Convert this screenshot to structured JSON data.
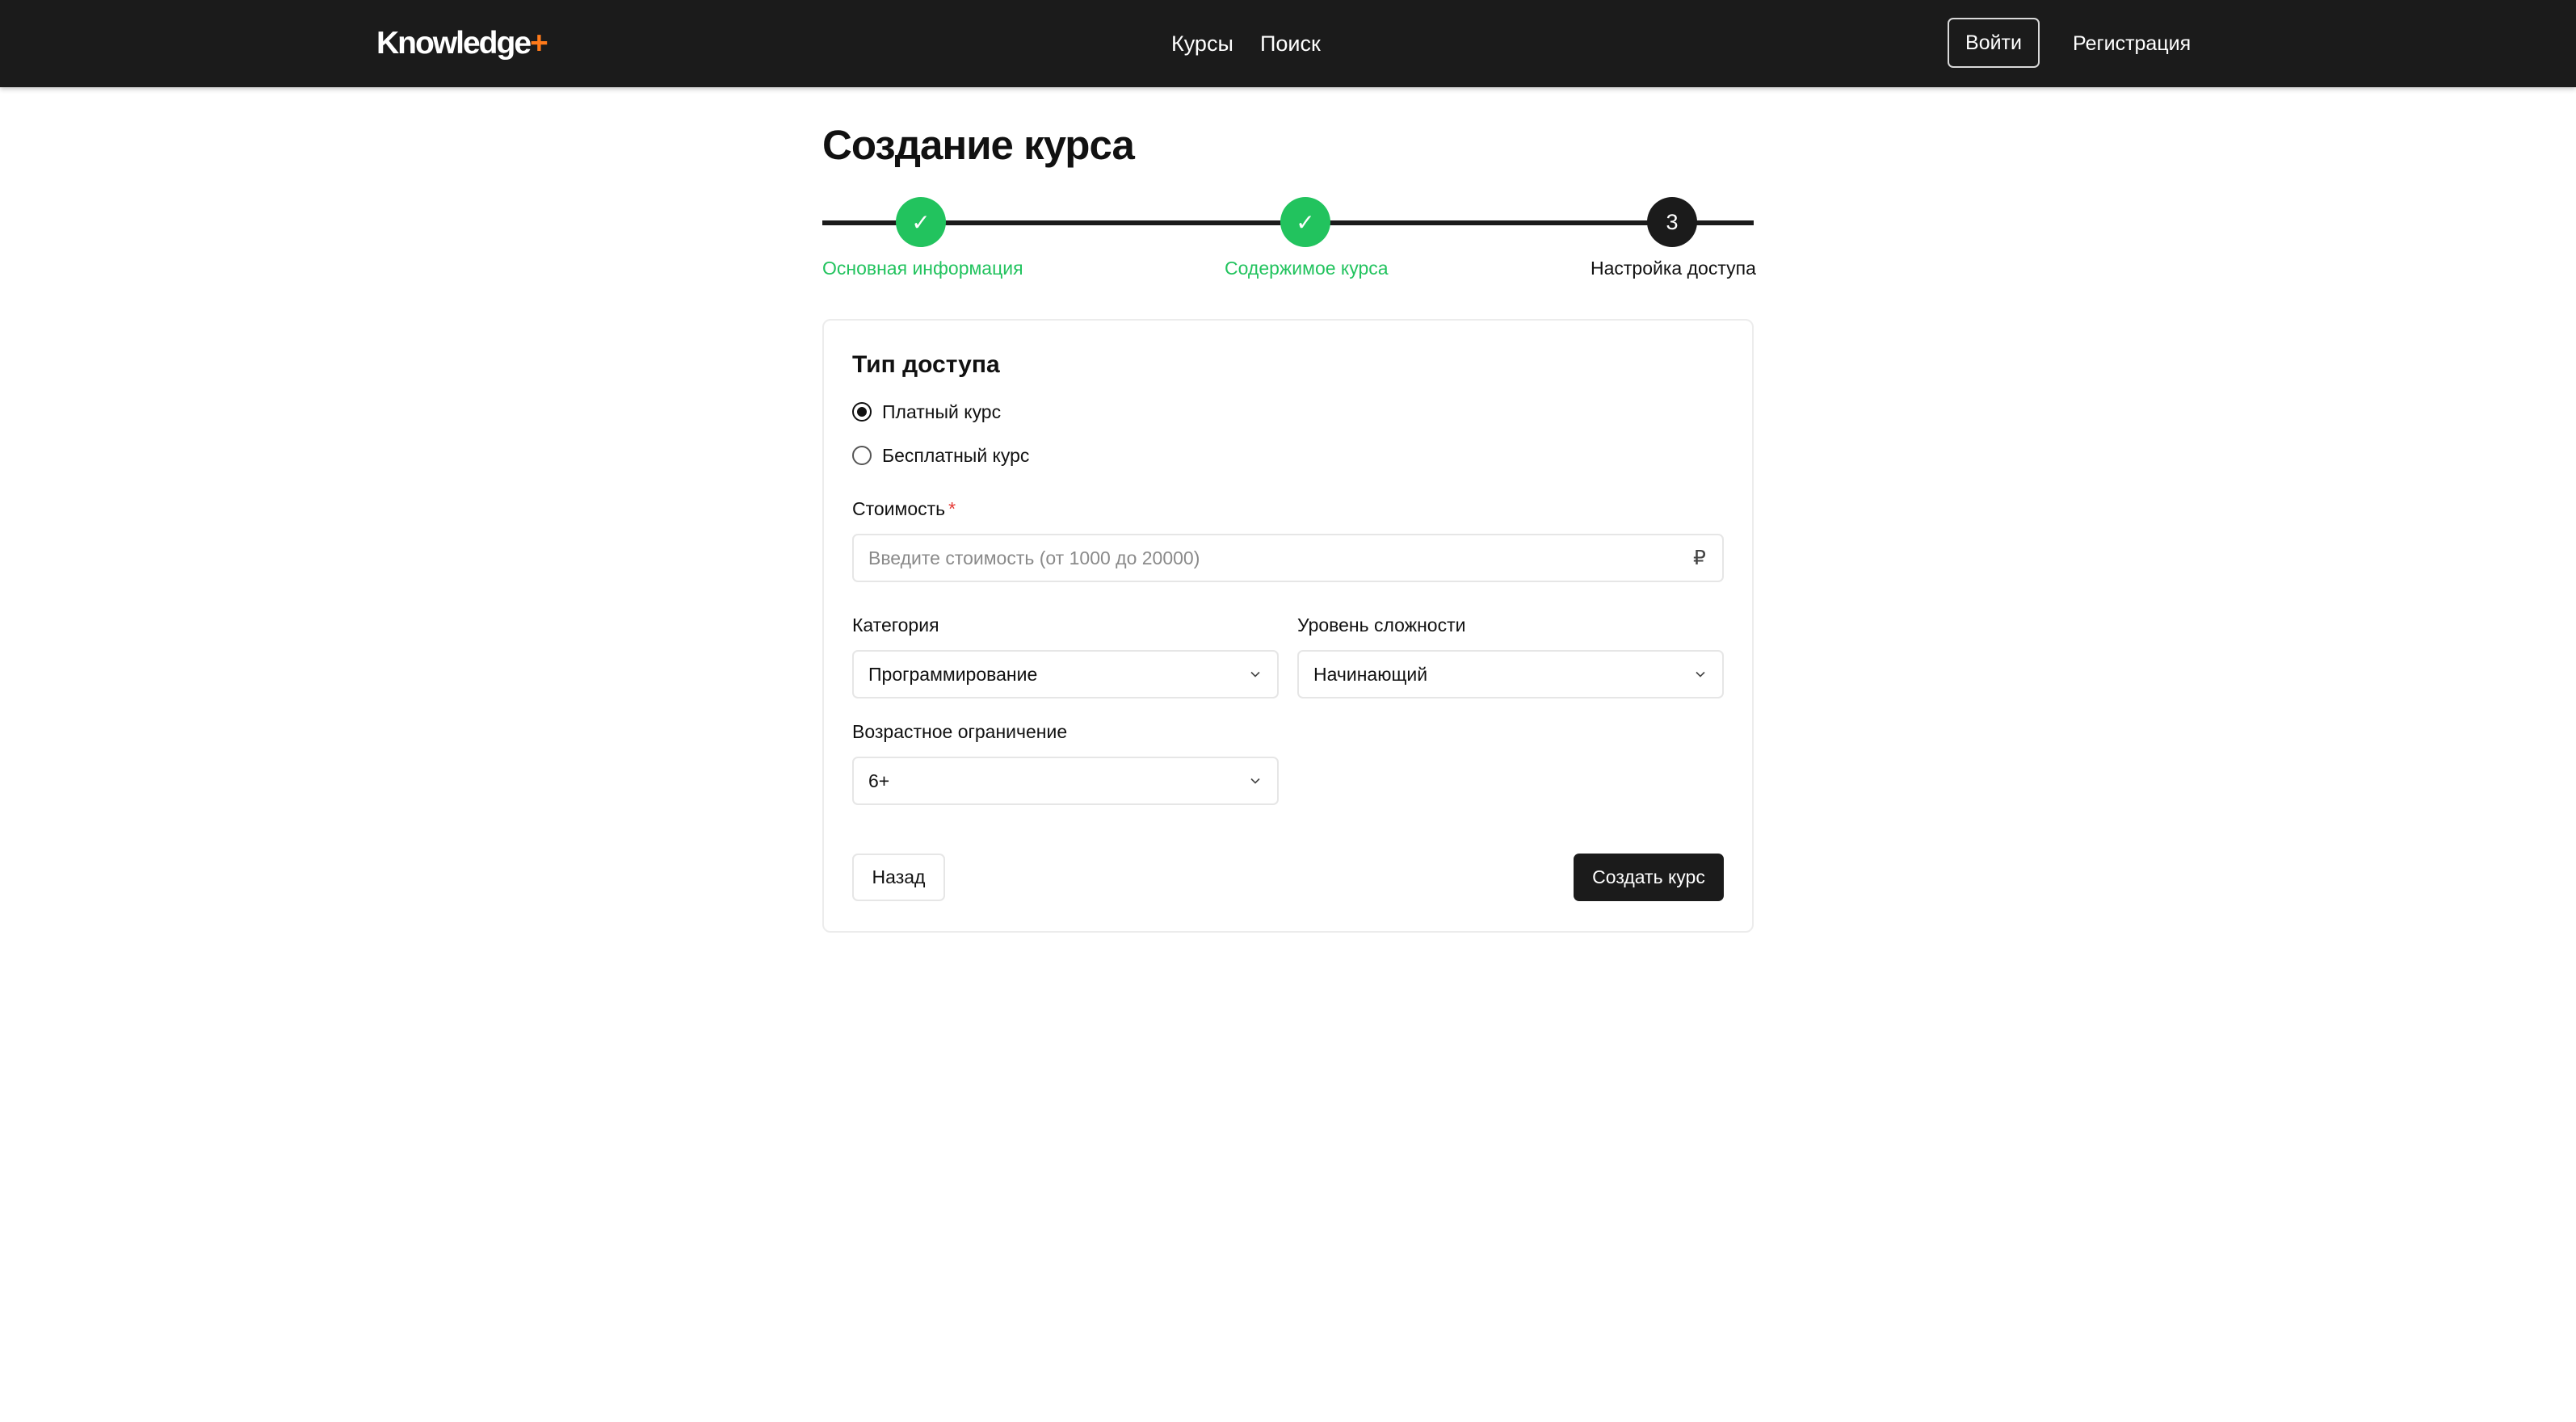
{
  "header": {
    "logo_text": "Knowledge",
    "logo_plus": "+",
    "nav": {
      "courses": "Курсы",
      "search": "Поиск"
    },
    "login_label": "Войти",
    "register_label": "Регистрация"
  },
  "page": {
    "title": "Создание курса"
  },
  "stepper": {
    "steps": [
      {
        "label": "Основная информация",
        "status": "done",
        "marker": "✓"
      },
      {
        "label": "Содержимое курса",
        "status": "done",
        "marker": "✓"
      },
      {
        "label": "Настройка доступа",
        "status": "active",
        "marker": "3"
      }
    ]
  },
  "form": {
    "access_type": {
      "title": "Тип доступа",
      "options": [
        {
          "label": "Платный курс",
          "checked": true
        },
        {
          "label": "Бесплатный курс",
          "checked": false
        }
      ]
    },
    "price": {
      "label": "Стоимость",
      "required_mark": "*",
      "value": "",
      "placeholder": "Введите стоимость (от 1000 до 20000)",
      "currency": "₽"
    },
    "category": {
      "label": "Категория",
      "value": "Программирование"
    },
    "level": {
      "label": "Уровень сложности",
      "value": "Начинающий"
    },
    "age": {
      "label": "Возрастное ограничение",
      "value": "6+"
    },
    "back_label": "Назад",
    "submit_label": "Создать курс"
  },
  "colors": {
    "header_bg": "#1b1b1b",
    "accent_plus": "#ff7a1a",
    "step_done": "#22c35e",
    "step_active": "#1b1b1b",
    "required": "#e53935"
  }
}
